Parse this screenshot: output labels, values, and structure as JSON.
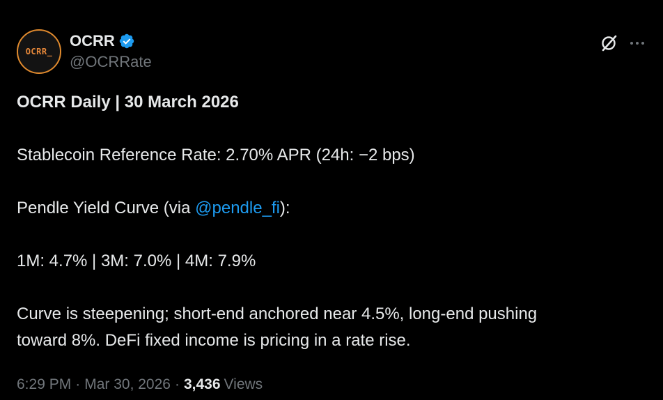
{
  "author": {
    "avatar_text": "OCRR_",
    "display_name": "OCRR",
    "handle": "@OCRRate",
    "verified": true
  },
  "icons": {
    "verified": "verified-badge-icon",
    "grok": "grok-icon",
    "more": "more-horizontal-icon"
  },
  "colors": {
    "background": "#000000",
    "text": "#e7e9ea",
    "muted": "#71767b",
    "link": "#1d9bf0",
    "avatar_accent": "#e08a2e"
  },
  "post": {
    "title": "OCRR Daily | 30 March 2026",
    "reference_rate": "Stablecoin Reference Rate: 2.70% APR (24h: −2 bps)",
    "curve_prefix": "Pendle Yield Curve (via ",
    "curve_mention": "@pendle_fi",
    "curve_suffix": "):",
    "tenors": "1M: 4.7% | 3M: 7.0% | 4M: 7.9%",
    "analysis_line1": "Curve is steepening; short-end anchored near 4.5%, long-end pushing",
    "analysis_line2": "toward 8%. DeFi fixed income is pricing in a rate rise."
  },
  "meta": {
    "time": "6:29 PM",
    "separator": "·",
    "date": "Mar 30, 2026",
    "views_count": "3,436",
    "views_label": "Views"
  }
}
